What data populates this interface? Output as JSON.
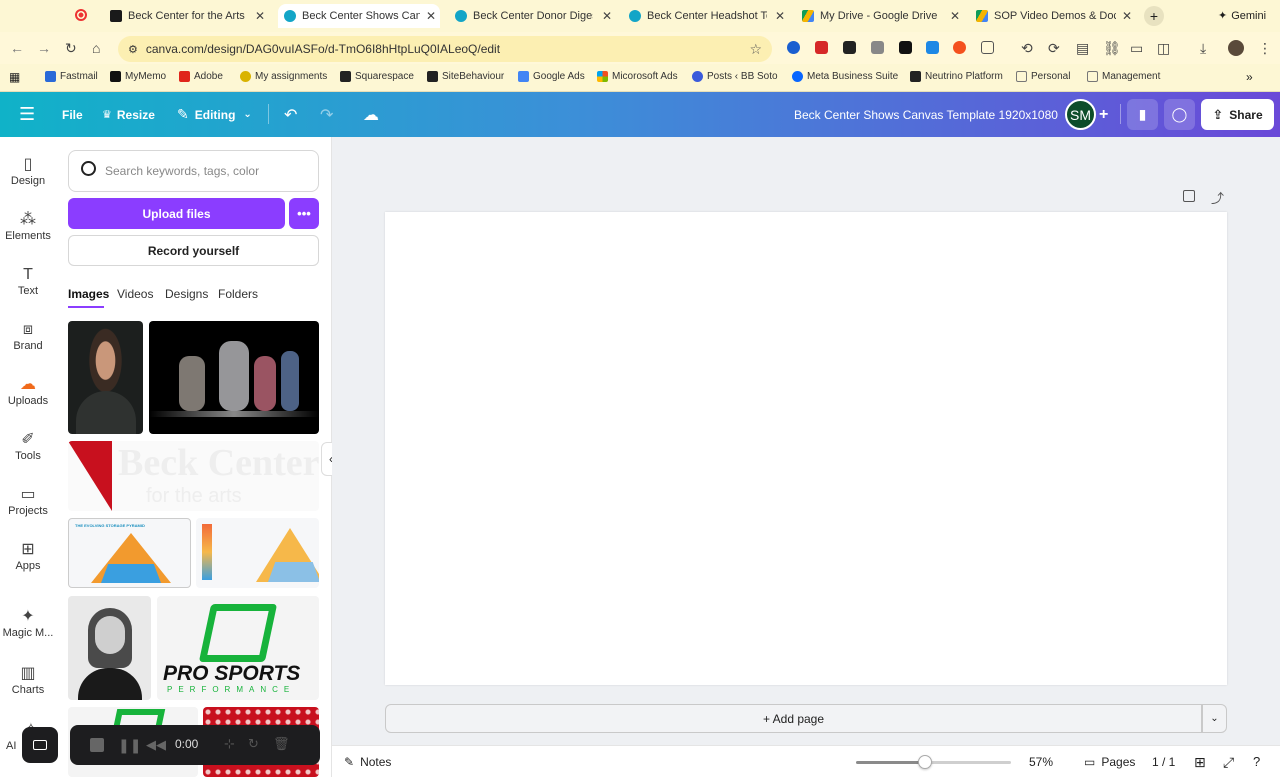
{
  "browser": {
    "tabs": [
      {
        "title": "Beck Center for the Arts – ",
        "favicon_color": "#1a1a1a",
        "active": false
      },
      {
        "title": "Beck Center Shows Canva",
        "favicon_color": "#13a5c7",
        "active": true
      },
      {
        "title": "Beck Center Donor Digest",
        "favicon_color": "#13a5c7",
        "active": false
      },
      {
        "title": "Beck Center Headshot Tem",
        "favicon_color": "#13a5c7",
        "active": false
      },
      {
        "title": "My Drive - Google Drive",
        "favicon_color": "#f4b400",
        "active": false
      },
      {
        "title": "SOP Video Demos & Docs",
        "favicon_color": "#f4b400",
        "active": false
      }
    ],
    "gemini_label": "Gemini",
    "url": "canva.com/design/DAG0vuIASFo/d-TmO6I8hHtpLuQ0IALeoQ/edit",
    "bookmarks": [
      {
        "label": "Fastmail",
        "color": "#2a6ad8"
      },
      {
        "label": "MyMemo",
        "color": "#111"
      },
      {
        "label": "Adobe",
        "color": "#e0261b"
      },
      {
        "label": "My assignments",
        "color": "#d9b300"
      },
      {
        "label": "Squarespace",
        "color": "#222"
      },
      {
        "label": "SiteBehaviour",
        "color": "#222"
      },
      {
        "label": "Google Ads",
        "color": "#4285f4"
      },
      {
        "label": "Micorosoft Ads",
        "color": "#f25022"
      },
      {
        "label": "Posts ‹ BB Soto",
        "color": "#3b5bdb"
      },
      {
        "label": "Meta Business Suite",
        "color": "#0866ff"
      },
      {
        "label": "Neutrino Platform",
        "color": "#222"
      },
      {
        "label": "Personal",
        "color": "#777"
      },
      {
        "label": "Management",
        "color": "#777"
      }
    ]
  },
  "header": {
    "file_label": "File",
    "resize_label": "Resize",
    "editing_label": "Editing",
    "design_title": "Beck Center Shows Canvas Template 1920x1080",
    "avatar_initials": "SM",
    "share_label": "Share"
  },
  "rail": [
    {
      "label": "Design",
      "icon": "layout-icon"
    },
    {
      "label": "Elements",
      "icon": "shapes-icon"
    },
    {
      "label": "Text",
      "icon": "text-icon"
    },
    {
      "label": "Brand",
      "icon": "briefcase-icon"
    },
    {
      "label": "Uploads",
      "icon": "cloud-upload-icon"
    },
    {
      "label": "Tools",
      "icon": "pen-icon"
    },
    {
      "label": "Projects",
      "icon": "folder-icon"
    },
    {
      "label": "Apps",
      "icon": "apps-icon"
    },
    {
      "label": "Magic M...",
      "icon": "magic-icon"
    },
    {
      "label": "Charts",
      "icon": "chart-icon"
    },
    {
      "label": "AI",
      "icon": "ai-icon"
    }
  ],
  "panel": {
    "search_placeholder": "Search keywords, tags, color",
    "upload_label": "Upload files",
    "more_label": "•••",
    "record_label": "Record yourself",
    "tabs": [
      "Images",
      "Videos",
      "Designs",
      "Folders"
    ],
    "thumb_texts": {
      "beck_logo": "Beck Center",
      "beck_sub": "for the arts",
      "pyramid_title": "THE EVOLVING STORAGE PYRAMID",
      "pro_sports": "PRO SPORTS",
      "performance": "PERFORMANCE"
    }
  },
  "canvas": {
    "add_page_label": "+ Add page"
  },
  "footer": {
    "notes_label": "Notes",
    "zoom": "57%",
    "pages_label": "Pages",
    "page_count": "1 / 1"
  },
  "recorder": {
    "time": "0:00"
  }
}
